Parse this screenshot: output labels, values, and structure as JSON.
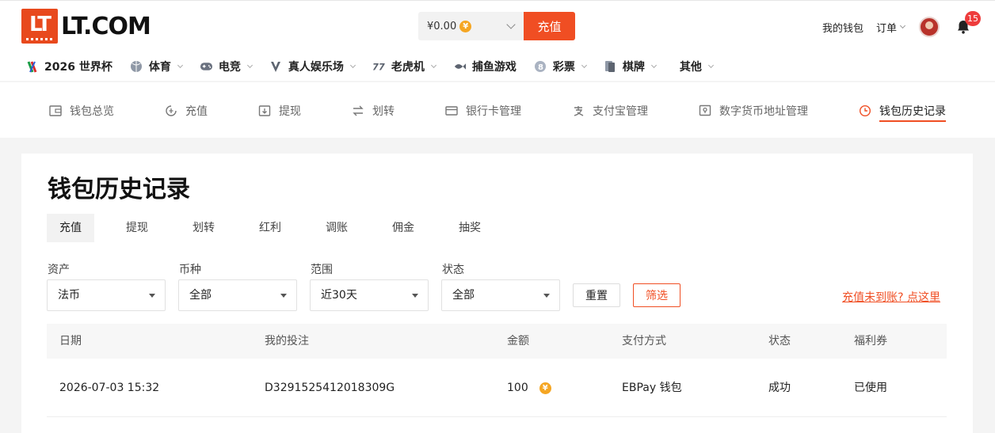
{
  "header": {
    "logo_mark": "LT",
    "logo_text": "LT.COM",
    "balance": "¥0.00",
    "balance_coin": "¥",
    "recharge_button": "充值",
    "wallet_link": "我的钱包",
    "orders_link": "订单",
    "notification_count": "15"
  },
  "nav": {
    "items": [
      {
        "label": "2026 世界杯",
        "icon": "worldcup-icon",
        "has_dropdown": false
      },
      {
        "label": "体育",
        "icon": "ball-icon",
        "has_dropdown": true
      },
      {
        "label": "电竞",
        "icon": "gamepad-icon",
        "has_dropdown": true
      },
      {
        "label": "真人娱乐场",
        "icon": "spade-icon",
        "has_dropdown": true
      },
      {
        "label": "老虎机",
        "icon": "slot-icon",
        "has_dropdown": true
      },
      {
        "label": "捕鱼游戏",
        "icon": "fish-icon",
        "has_dropdown": false
      },
      {
        "label": "彩票",
        "icon": "lottery-icon",
        "has_dropdown": true
      },
      {
        "label": "棋牌",
        "icon": "cards-icon",
        "has_dropdown": true
      },
      {
        "label": "其他",
        "icon": "",
        "has_dropdown": true
      }
    ]
  },
  "wallet_tabs": [
    {
      "label": "钱包总览",
      "icon": "wallet-icon",
      "active": false
    },
    {
      "label": "充值",
      "icon": "deposit-icon",
      "active": false
    },
    {
      "label": "提现",
      "icon": "withdraw-icon",
      "active": false
    },
    {
      "label": "划转",
      "icon": "transfer-icon",
      "active": false
    },
    {
      "label": "银行卡管理",
      "icon": "bank-card-icon",
      "active": false
    },
    {
      "label": "支付宝管理",
      "icon": "alipay-icon",
      "active": false
    },
    {
      "label": "数字货币地址管理",
      "icon": "crypto-address-icon",
      "active": false
    },
    {
      "label": "钱包历史记录",
      "icon": "history-clock-icon",
      "active": true
    }
  ],
  "main": {
    "title": "钱包历史记录",
    "type_tabs": [
      "充值",
      "提现",
      "划转",
      "红利",
      "调账",
      "佣金",
      "抽奖"
    ],
    "active_type_tab": "充值",
    "filters": {
      "asset": {
        "label": "资产",
        "value": "法币"
      },
      "currency": {
        "label": "币种",
        "value": "全部"
      },
      "range": {
        "label": "范围",
        "value": "近30天"
      },
      "status": {
        "label": "状态",
        "value": "全部"
      }
    },
    "reset_button": "重置",
    "filter_button": "筛选",
    "help_link": "充值未到账? 点这里"
  },
  "table": {
    "columns": [
      "日期",
      "我的投注",
      "金额",
      "支付方式",
      "状态",
      "福利券"
    ],
    "rows": [
      {
        "date": "2026-07-03 15:32",
        "bet_id": "D3291525412018309G",
        "amount": "100",
        "amount_coin": "¥",
        "payment": "EBPay 钱包",
        "status": "成功",
        "coupon": "已使用"
      }
    ]
  },
  "colors": {
    "accent": "#f04e23",
    "coin": "#f5a623",
    "badge": "#ee3c3c"
  }
}
